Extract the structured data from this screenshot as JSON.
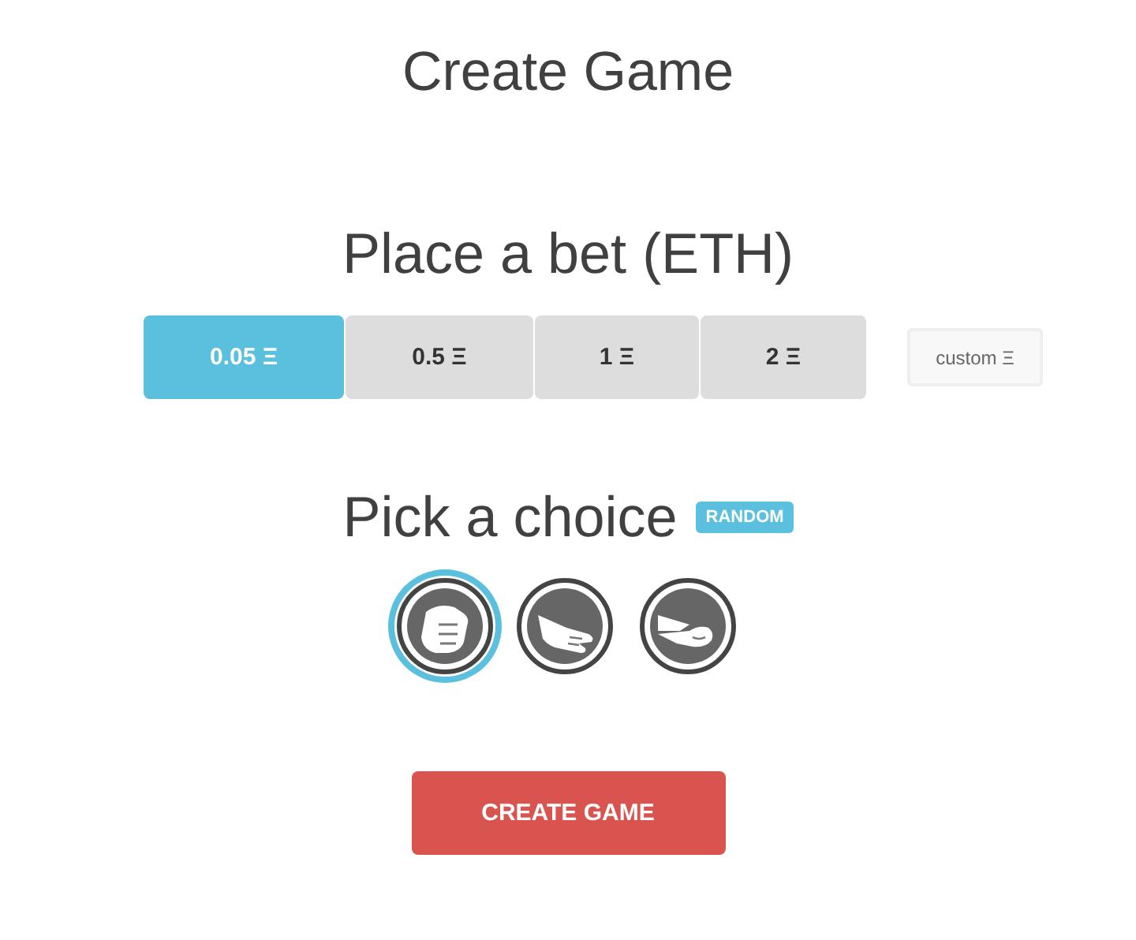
{
  "title": "Create Game",
  "bet": {
    "heading": "Place a bet (ETH)",
    "options": [
      {
        "label": "0.05 Ξ",
        "selected": true
      },
      {
        "label": "0.5 Ξ",
        "selected": false
      },
      {
        "label": "1 Ξ",
        "selected": false
      },
      {
        "label": "2 Ξ",
        "selected": false
      }
    ],
    "custom": {
      "placeholder": "custom Ξ"
    }
  },
  "choice": {
    "heading": "Pick a choice",
    "random_label": "RANDOM",
    "options": [
      {
        "kind": "rock",
        "selected": true
      },
      {
        "kind": "paper",
        "selected": false
      },
      {
        "kind": "scissors",
        "selected": false
      }
    ]
  },
  "submit": "CREATE GAME"
}
